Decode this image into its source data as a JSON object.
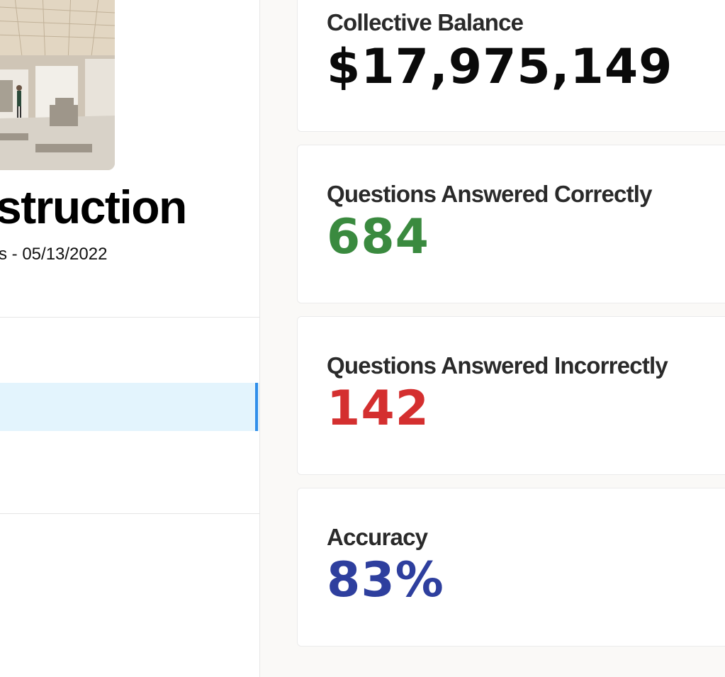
{
  "game": {
    "title": "struction",
    "meta": "s - 05/13/2022"
  },
  "stats": [
    {
      "label": "Collective Balance",
      "value": "$17,975,149",
      "color": "#0a0a0a"
    },
    {
      "label": "Questions Answered Correctly",
      "value": "684",
      "color": "#3a8a3f"
    },
    {
      "label": "Questions Answered Incorrectly",
      "value": "142",
      "color": "#d42f2f"
    },
    {
      "label": "Accuracy",
      "value": "83%",
      "color": "#2e3f9e"
    }
  ],
  "colors": {
    "accent": "#2f8eea",
    "active_bg": "#e3f4fd",
    "content_bg": "#faf9f7"
  }
}
